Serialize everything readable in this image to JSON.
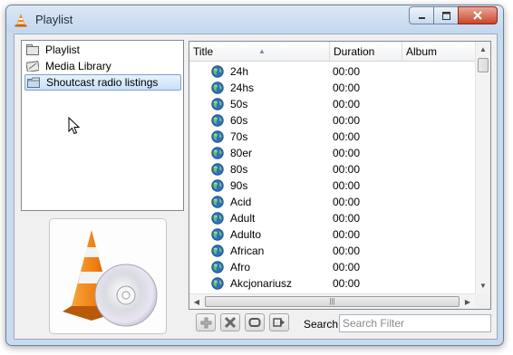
{
  "window": {
    "title": "Playlist"
  },
  "sidebar": {
    "items": [
      {
        "label": "Playlist",
        "icon": "playlist-icon"
      },
      {
        "label": "Media Library",
        "icon": "media-library-icon"
      },
      {
        "label": "Shoutcast radio listings",
        "icon": "folder-icon",
        "selected": true
      }
    ]
  },
  "playlist": {
    "columns": [
      "Title",
      "Duration",
      "Album"
    ],
    "rows": [
      {
        "title": "24h",
        "duration": "00:00"
      },
      {
        "title": "24hs",
        "duration": "00:00"
      },
      {
        "title": "50s",
        "duration": "00:00"
      },
      {
        "title": "60s",
        "duration": "00:00"
      },
      {
        "title": "70s",
        "duration": "00:00"
      },
      {
        "title": "80er",
        "duration": "00:00"
      },
      {
        "title": "80s",
        "duration": "00:00"
      },
      {
        "title": "90s",
        "duration": "00:00"
      },
      {
        "title": "Acid",
        "duration": "00:00"
      },
      {
        "title": "Adult",
        "duration": "00:00"
      },
      {
        "title": "Adulto",
        "duration": "00:00"
      },
      {
        "title": "African",
        "duration": "00:00"
      },
      {
        "title": "Afro",
        "duration": "00:00"
      },
      {
        "title": "Akcjonariusz",
        "duration": "00:00"
      }
    ]
  },
  "toolbar": {
    "search_label": "Search",
    "search_placeholder": "Search Filter"
  },
  "colors": {
    "accent": "#3c7fd0",
    "cone_orange": "#f08c1e"
  }
}
